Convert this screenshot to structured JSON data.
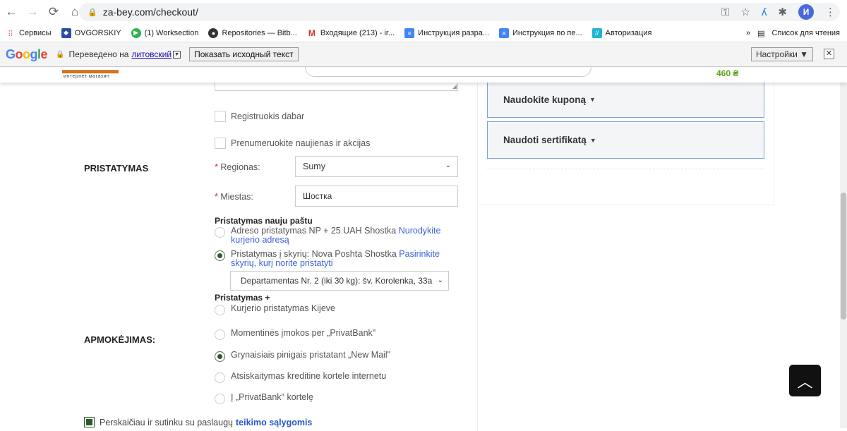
{
  "browser": {
    "url": "za-bey.com/checkout/",
    "profile_initial": "И",
    "icons": [
      "back-icon",
      "forward-icon",
      "reload-icon",
      "home-icon",
      "lock-icon",
      "key-icon",
      "star-icon",
      "extension-icon",
      "puzzle-icon",
      "menu-icon"
    ]
  },
  "bookmarks": {
    "items": [
      {
        "label": "Сервисы",
        "icon": "apps-icon",
        "color": "#e04a3b"
      },
      {
        "label": "OVGORSKIY",
        "icon": "ovgorskiy-icon",
        "color": "#2b4fa3"
      },
      {
        "label": "(1) Worksection",
        "icon": "worksection-icon",
        "color": "#2fb34f"
      },
      {
        "label": "Repositories — Bitb...",
        "icon": "bitbucket-icon",
        "color": "#333333"
      },
      {
        "label": "Входящие (213) - ir...",
        "icon": "gmail-icon",
        "color": "#d93025"
      },
      {
        "label": "Инструкция разра...",
        "icon": "docs-icon",
        "color": "#4285f4"
      },
      {
        "label": "Инструкция по пе...",
        "icon": "docs-icon",
        "color": "#4285f4"
      },
      {
        "label": "Авторизация",
        "icon": "auth-icon",
        "color": "#1fb5d4"
      }
    ],
    "more": "»",
    "reading_list": "Список для чтения"
  },
  "translate": {
    "logo": "Google",
    "translated_to": "Переведено на",
    "language": "литовский",
    "show_original": "Показать исходный текст",
    "settings": "Настройки ▼",
    "close": "✕"
  },
  "site_header": {
    "logo_sub": "интернет магазин",
    "cart_total": "460 ₴"
  },
  "form": {
    "register_now": "Registruokis dabar",
    "subscribe": "Prenumeruokite naujienas ir akcijas",
    "delivery_section": "PRISTATYMAS",
    "region_label": "Regionas:",
    "region_value": "Sumy",
    "city_label": "Miestas:",
    "city_value": "Шостка",
    "np_group_title": "Pristatymas nauju paštu",
    "np_address_text": "Adreso pristatymas NP + 25 UAH Shostka",
    "np_address_link": "Nurodykite kurjerio adresą",
    "np_branch_text": "Pristatymas į skyrių: Nova Poshta Shostka",
    "np_branch_link": "Pasirinkite skyrių, kurį norite pristatyti",
    "branch_select_value": "Departamentas Nr. 2 (iki 30 kg): šv. Korolenka, 33a",
    "plus_group_title": "Pristatymas +",
    "courier_kiev": "Kurjerio pristatymas Kijeve",
    "payment_section": "APMOKĖJIMAS:",
    "pay_privat_instant": "Momentinės įmokos per „PrivatBank\"",
    "pay_cash": "Grynaisiais pinigais pristatant „New Mail\"",
    "pay_card_online": "Atsiskaitymas kreditine kortele internetu",
    "pay_privat_card": "Į „PrivatBank\" kortelę",
    "terms_text": "Perskaičiau ir sutinku su paslaugų",
    "terms_link": "teikimo sąlygomis",
    "required_mark": "*"
  },
  "sidebar": {
    "coupon": "Naudokite kuponą",
    "certificate": "Naudoti sertifikatą"
  },
  "colors": {
    "accent_green": "#2c5a2c",
    "link_blue": "#3b63d9",
    "accordion_border": "#7ba0d8"
  }
}
